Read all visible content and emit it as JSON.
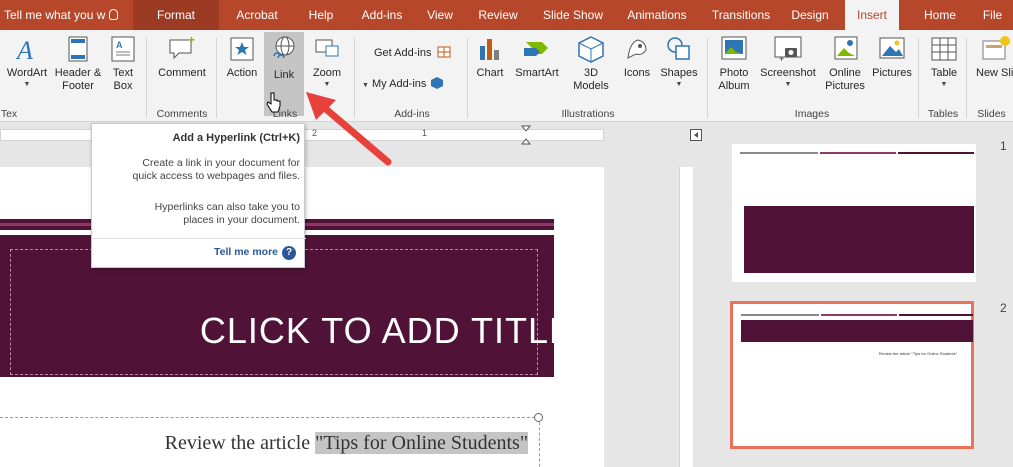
{
  "tabs": {
    "file": "File",
    "home": "Home",
    "insert": "Insert",
    "design": "Design",
    "transitions": "Transitions",
    "animations": "Animations",
    "slideshow": "Slide Show",
    "review": "Review",
    "view": "View",
    "addins": "Add-ins",
    "help": "Help",
    "acrobat": "Acrobat",
    "format": "Format",
    "tellme": "Tell me what you w"
  },
  "ribbon": {
    "new_slide": "New Slide",
    "table": "Table",
    "pictures": "Pictures",
    "online_pictures": "Online Pictures",
    "screenshot": "Screenshot",
    "photo_album": "Photo Album",
    "shapes": "Shapes",
    "icons": "Icons",
    "models_3d": "3D Models",
    "smartart": "SmartArt",
    "chart": "Chart",
    "get_addins": "Get Add-ins",
    "my_addins": "My Add-ins",
    "zoom": "Zoom",
    "link": "Link",
    "action": "Action",
    "comment": "Comment",
    "text_box": "Text Box",
    "header_footer": "Header & Footer",
    "wordart": "WordArt",
    "groups": {
      "slides": "Slides",
      "tables": "Tables",
      "images": "Images",
      "illustrations": "Illustrations",
      "addins": "Add-ins",
      "links": "Links",
      "comments": "Comments",
      "text": "Tex"
    }
  },
  "tooltip": {
    "title": "Add a Hyperlink (Ctrl+K)",
    "p1_l1": "Create a link in your document for",
    "p1_l2": "quick access to webpages and files.",
    "p2_l1": "Hyperlinks can also take you to",
    "p2_l2": "places in your document.",
    "more": "Tell me more"
  },
  "ruler": {
    "n1": "1",
    "n2": "2"
  },
  "slide": {
    "title": "CLICK TO ADD TITLE",
    "body_prefix": "Review the article ",
    "body_highlight": "\"Tips for Online Students\""
  },
  "thumbnails": {
    "n1": "1",
    "n2": "2",
    "slide2_text": "Review the article \"Tips for Online Students\""
  },
  "colors": {
    "accent": "#b7472a",
    "slide_dark": "#501337",
    "arrow": "#e8413c",
    "selected_thumb": "#e8735a"
  }
}
